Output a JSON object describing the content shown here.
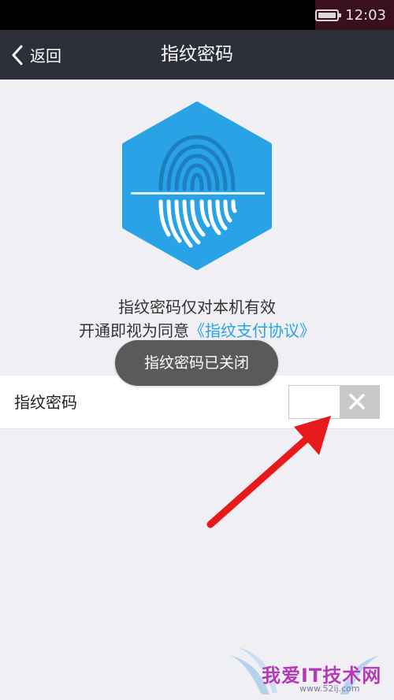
{
  "status_bar": {
    "time": "12:03",
    "battery_icon": "battery-icon"
  },
  "nav": {
    "back_label": "返回",
    "title": "指纹密码"
  },
  "hero": {
    "icon": "fingerprint-hex-icon",
    "color": "#2aa3e6"
  },
  "description": {
    "line1": "指纹密码仅对本机有效",
    "line2_prefix": "开通即视为同意",
    "line2_link": "《指纹支付协议》"
  },
  "toast": {
    "text": "指纹密码已关闭"
  },
  "setting": {
    "label": "指纹密码",
    "toggle_state": "off"
  },
  "annotation": {
    "arrow_color": "#e8191b"
  },
  "watermark": {
    "text": "我爱IT技术网",
    "url": "www.52ij.com"
  }
}
